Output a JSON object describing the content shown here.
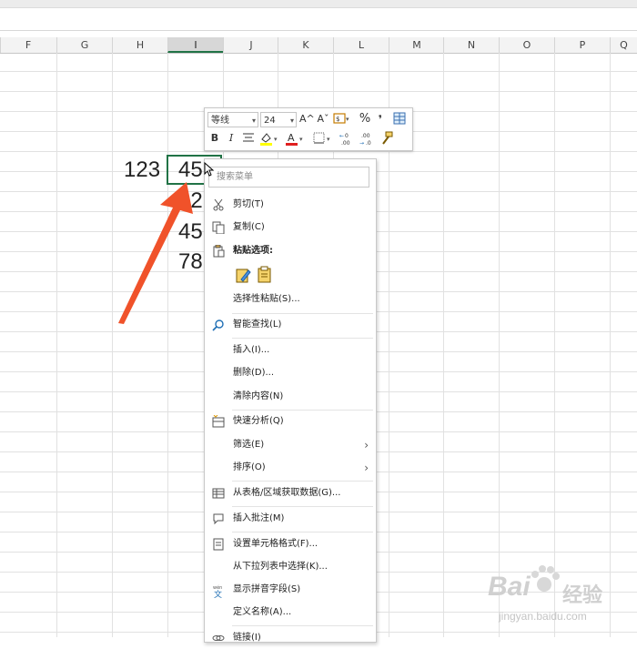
{
  "sheet": {
    "columns": [
      "F",
      "G",
      "H",
      "I",
      "J",
      "K",
      "L",
      "M",
      "N",
      "O",
      "P",
      "Q"
    ],
    "selected_column": "I",
    "cells": {
      "h_row1": "123",
      "i_row1": "45",
      "i_row2": "12",
      "i_row3": "45",
      "i_row4": "78"
    }
  },
  "mini_toolbar": {
    "font_name": "等线",
    "font_size": "24",
    "bold": "B",
    "italic": "I",
    "grow_font": "A^",
    "shrink_font": "Aˇ",
    "percent": "%",
    "comma": "❜"
  },
  "context_menu": {
    "search_placeholder": "搜索菜单",
    "items": [
      {
        "label": "剪切(T)",
        "icon": "scissors-icon"
      },
      {
        "label": "复制(C)",
        "icon": "copy-icon"
      },
      {
        "label": "粘贴选项:",
        "icon": "paste-icon"
      },
      {
        "label": "选择性粘贴(S)...",
        "icon": ""
      },
      {
        "label": "智能查找(L)",
        "icon": "search-icon"
      },
      {
        "label": "插入(I)...",
        "icon": ""
      },
      {
        "label": "删除(D)...",
        "icon": ""
      },
      {
        "label": "清除内容(N)",
        "icon": ""
      },
      {
        "label": "快速分析(Q)",
        "icon": "quick-analysis-icon"
      },
      {
        "label": "筛选(E)",
        "icon": "",
        "submenu": true
      },
      {
        "label": "排序(O)",
        "icon": "",
        "submenu": true
      },
      {
        "label": "从表格/区域获取数据(G)...",
        "icon": "table-icon"
      },
      {
        "label": "插入批注(M)",
        "icon": "comment-icon"
      },
      {
        "label": "设置单元格格式(F)...",
        "icon": "format-cells-icon"
      },
      {
        "label": "从下拉列表中选择(K)...",
        "icon": ""
      },
      {
        "label": "显示拼音字段(S)",
        "icon": "phonetic-icon"
      },
      {
        "label": "定义名称(A)...",
        "icon": ""
      },
      {
        "label": "链接(I)",
        "icon": "link-icon"
      }
    ],
    "phonetic_icon_text": "wén\n文"
  },
  "watermark": {
    "brand": "Bai",
    "brand2": "经验",
    "url": "jingyan.baidu.com"
  },
  "colors": {
    "accent_green": "#217346",
    "arrow_orange": "#f0522a"
  }
}
